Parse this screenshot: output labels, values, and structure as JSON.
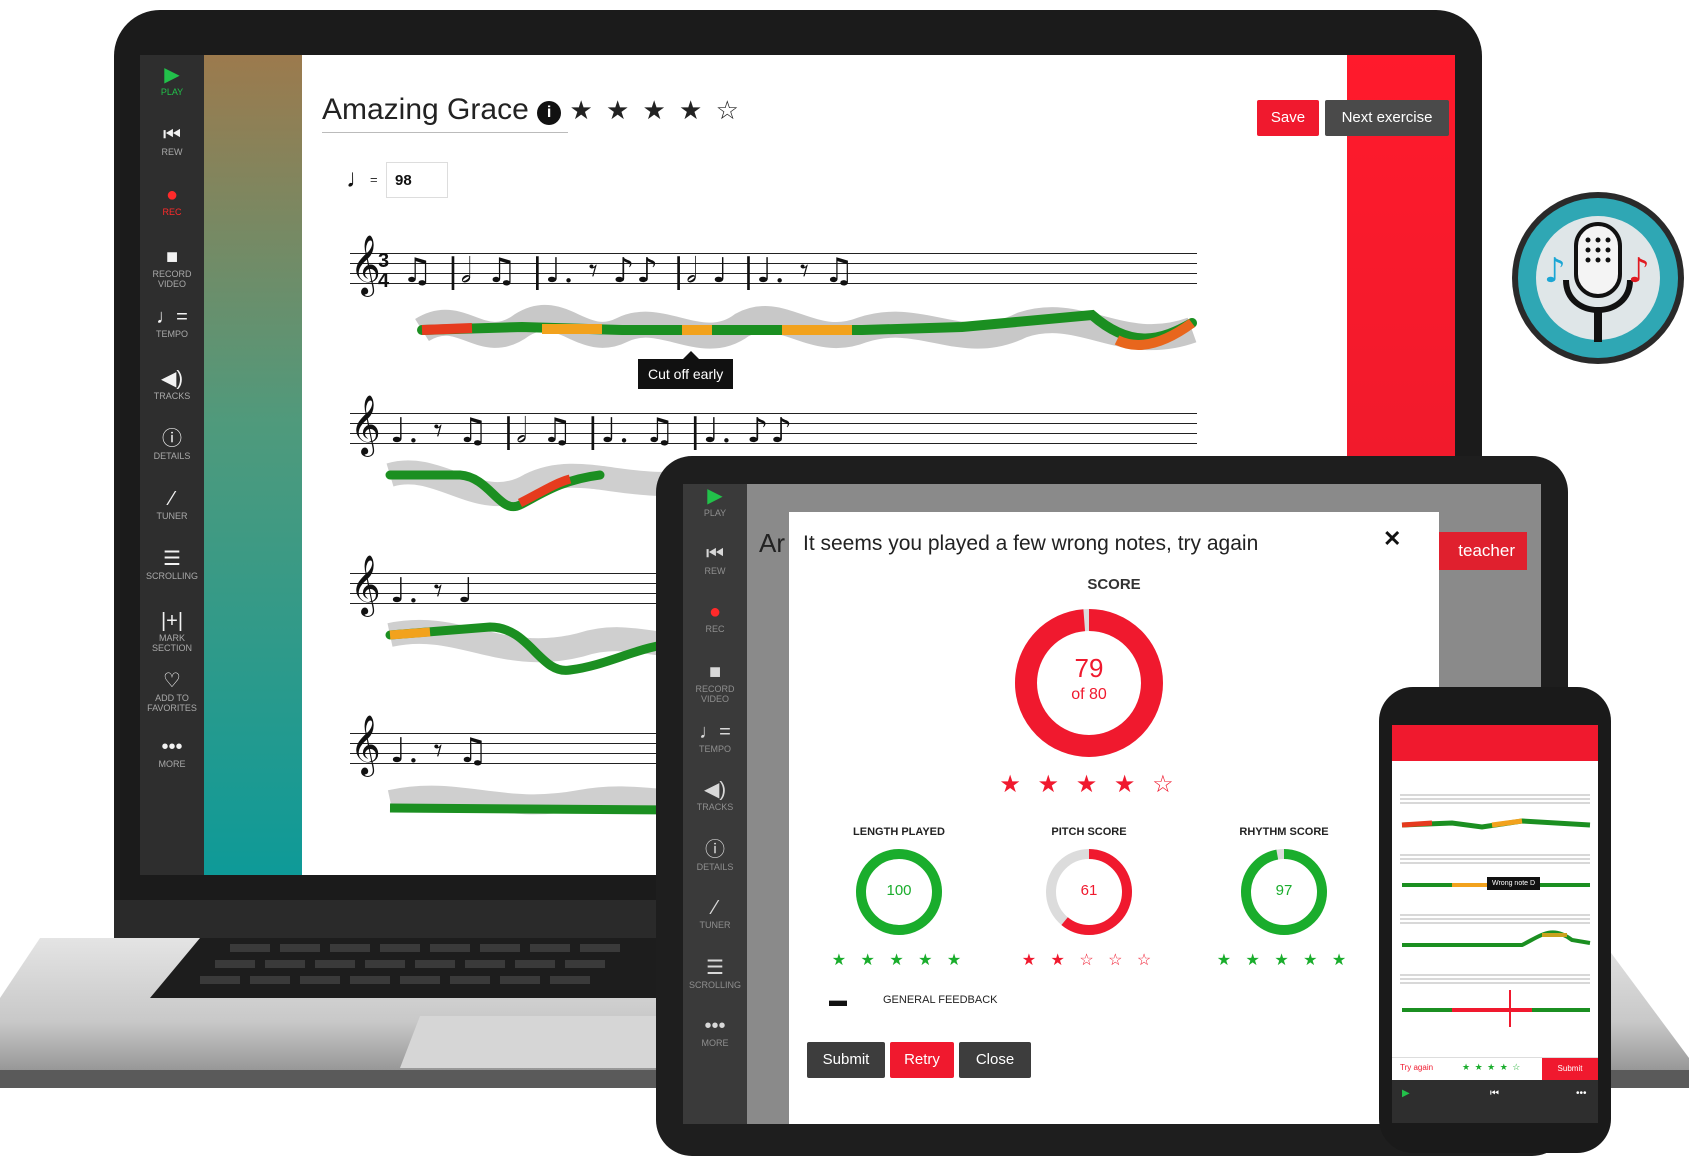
{
  "laptop": {
    "sidebar": [
      {
        "icon": "play-icon",
        "glyph": "▶",
        "label": "PLAY",
        "color": "#22c14a"
      },
      {
        "icon": "rewind-icon",
        "glyph": "⏮",
        "label": "REW",
        "color": "#f2f2f2"
      },
      {
        "icon": "record-icon",
        "glyph": "●",
        "label": "REC",
        "color": "#ff2a2a"
      },
      {
        "icon": "video-camera-icon",
        "glyph": "■",
        "label": "RECORD VIDEO",
        "color": "#f2f2f2"
      },
      {
        "icon": "tempo-icon",
        "glyph": "♩=",
        "label": "TEMPO",
        "color": "#f2f2f2"
      },
      {
        "icon": "speaker-icon",
        "glyph": "◀)",
        "label": "TRACKS",
        "color": "#f2f2f2"
      },
      {
        "icon": "info-icon",
        "glyph": "ⓘ",
        "label": "DETAILS",
        "color": "#f2f2f2"
      },
      {
        "icon": "tuner-icon",
        "glyph": "⁄",
        "label": "TUNER",
        "color": "#f2f2f2"
      },
      {
        "icon": "scrolling-icon",
        "glyph": "☰",
        "label": "SCROLLING",
        "color": "#f2f2f2"
      },
      {
        "icon": "mark-section-icon",
        "glyph": "|+|",
        "label": "MARK SECTION",
        "color": "#f2f2f2"
      },
      {
        "icon": "heart-icon",
        "glyph": "♡",
        "label": "ADD TO FAVORITES",
        "color": "#f2f2f2"
      },
      {
        "icon": "more-icon",
        "glyph": "•••",
        "label": "MORE",
        "color": "#f2f2f2"
      }
    ],
    "title": "Amazing Grace",
    "rating_stars": "★ ★ ★ ★ ☆",
    "tempo_value": "98",
    "tempo_eq": "=",
    "save_label": "Save",
    "next_label": "Next exercise",
    "tooltip": "Cut off early",
    "time_signature": "3\n4",
    "accent_red": "#f0192e",
    "accent_green": "#1b8f21"
  },
  "tablet": {
    "sidebar": [
      {
        "icon": "play-icon",
        "glyph": "▶",
        "label": "PLAY"
      },
      {
        "icon": "rewind-icon",
        "glyph": "⏮",
        "label": "REW"
      },
      {
        "icon": "record-icon",
        "glyph": "●",
        "label": "REC"
      },
      {
        "icon": "video-camera-icon",
        "glyph": "■",
        "label": "RECORD VIDEO"
      },
      {
        "icon": "tempo-icon",
        "glyph": "♩=",
        "label": "TEMPO"
      },
      {
        "icon": "speaker-icon",
        "glyph": "◀)",
        "label": "TRACKS"
      },
      {
        "icon": "info-icon",
        "glyph": "ⓘ",
        "label": "DETAILS"
      },
      {
        "icon": "tuner-icon",
        "glyph": "⁄",
        "label": "TUNER"
      },
      {
        "icon": "scrolling-icon",
        "glyph": "☰",
        "label": "SCROLLING"
      },
      {
        "icon": "more-icon",
        "glyph": "•••",
        "label": "MORE"
      }
    ],
    "bg_title": "Ar",
    "bg_button": "teacher",
    "modal": {
      "heading": "It seems you played a few wrong notes, try again",
      "close_glyph": "✕",
      "score_title": "SCORE",
      "score_value": "79",
      "score_of": "of 80",
      "score_fraction": 0.9875,
      "score_stars": "★ ★ ★ ★ ☆",
      "metrics": [
        {
          "label": "LENGTH PLAYED",
          "value": "100",
          "fraction": 1.0,
          "color": "#1aad2c",
          "stars": "★ ★ ★ ★ ★"
        },
        {
          "label": "PITCH SCORE",
          "value": "61",
          "fraction": 0.61,
          "color": "#f0192e",
          "stars": "★ ★ ☆ ☆ ☆"
        },
        {
          "label": "RHYTHM SCORE",
          "value": "97",
          "fraction": 0.97,
          "color": "#1aad2c",
          "stars": "★ ★ ★ ★ ★"
        }
      ],
      "feedback_label": "GENERAL FEEDBACK",
      "submit_label": "Submit",
      "retry_label": "Retry",
      "close_label": "Close"
    }
  },
  "phone": {
    "try_again": "Try again",
    "submit": "Submit",
    "stars": "★ ★ ★ ★ ☆",
    "wrong_note": "Wrong note D"
  }
}
